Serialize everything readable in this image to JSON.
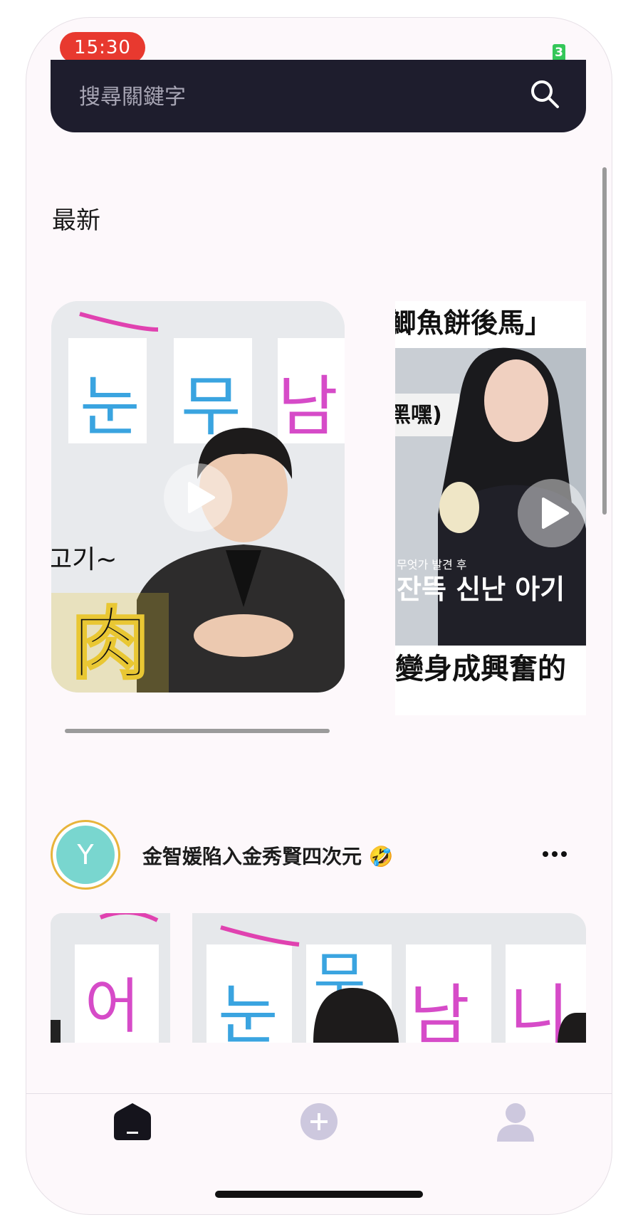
{
  "status_bar": {
    "time": "15:30",
    "battery": "3"
  },
  "search": {
    "placeholder": "搜尋關鍵字"
  },
  "section": {
    "title": "最新"
  },
  "carousel": {
    "card1": {
      "caption_left": "고기~",
      "caption_big": "肉",
      "signs": [
        "눈",
        "무",
        "남"
      ]
    },
    "card2": {
      "top_text": "鯽魚餅後馬」",
      "side_text": "黑嘿)",
      "sub_kr_small": "무엇가 발견 후",
      "sub_kr": "잔뜩 신난 아기",
      "bottom_text": "變身成興奮的"
    }
  },
  "post": {
    "avatar_letter": "Y",
    "title": "金智媛陷入金秀賢四次元 🤣",
    "image1_sign": "어",
    "image2_signs": [
      "눈",
      "무",
      "남",
      "니"
    ]
  },
  "nav": {
    "items": [
      "home",
      "add",
      "profile"
    ]
  },
  "colors": {
    "accent": "#e8392f",
    "search_bg": "#1e1d2d",
    "avatar": "#79d6cf",
    "nav_inactive": "#cdc8de"
  }
}
